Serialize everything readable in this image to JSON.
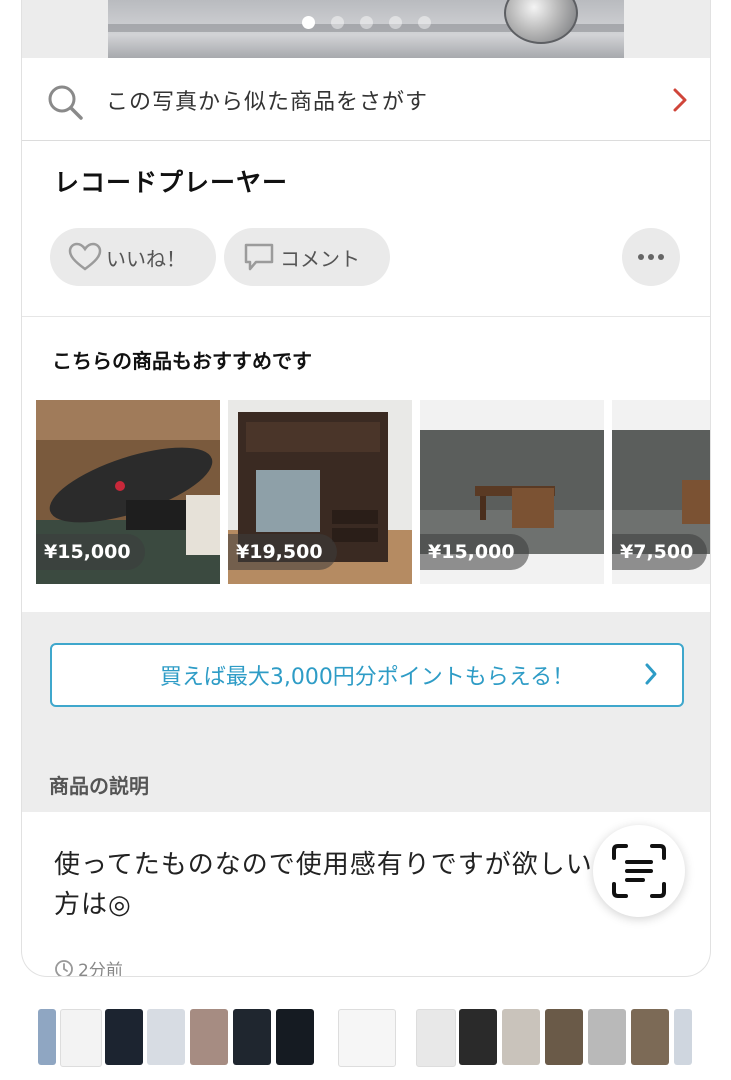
{
  "carousel": {
    "dot_count": 5,
    "active_index": 0
  },
  "photo_search": {
    "label": "この写真から似た商品をさがす"
  },
  "item": {
    "title": "レコードプレーヤー"
  },
  "actions": {
    "like_label": "いいね！",
    "comment_label": "コメント"
  },
  "recommend": {
    "heading": "こちらの商品もおすすめです",
    "items": [
      {
        "price": "¥15,000"
      },
      {
        "price": "¥19,500"
      },
      {
        "price": "¥15,000"
      },
      {
        "price": "¥7,500"
      }
    ]
  },
  "promo": {
    "label": "買えば最大3,000円分ポイントもらえる！"
  },
  "description": {
    "heading": "商品の説明",
    "text": "使ってたものなので使用感有りですが欲しい方は◎",
    "posted": "2分前"
  },
  "colors": {
    "accent_blue": "#2e9cc6",
    "chevron_red": "#d0453a"
  },
  "icons": [
    "search-icon",
    "chevron-right-icon",
    "heart-icon",
    "comment-icon",
    "more-icon",
    "clock-icon",
    "text-scan-icon"
  ]
}
